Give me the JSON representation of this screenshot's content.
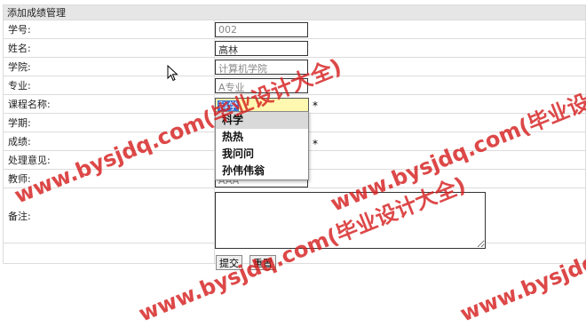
{
  "form": {
    "title": "添加成绩管理",
    "labels": {
      "student_id": "学号:",
      "name": "姓名:",
      "college": "学院:",
      "major": "专业:",
      "course": "课程名称:",
      "term": "学期:",
      "score": "成绩:",
      "opinion": "处理意见:",
      "teacher": "教师:",
      "remark": "备注:"
    },
    "values": {
      "student_id": "002",
      "name": "高林",
      "college": "计算机学院",
      "major": "A专业",
      "course": "科学",
      "teacher": "AAA"
    },
    "required_mark": "*",
    "course_options": [
      "科学",
      "热热",
      "我问问",
      "孙伟伟翁"
    ],
    "submit_label": "提交",
    "reset_label": "重置"
  },
  "watermarks": [
    "www.bysjdq.com(毕业设计大全)",
    "www.bysjdq.com(毕业设计大全)",
    "www.bysjdq.com(毕业设计大全)",
    "www.bysjdq.com(毕业设计大全)"
  ]
}
